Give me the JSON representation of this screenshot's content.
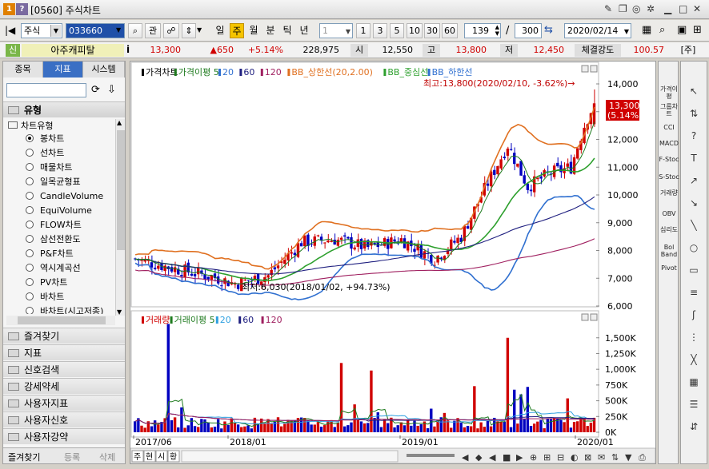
{
  "window": {
    "title": "[0560] 주식차트",
    "badge1": "1",
    "badge2": "?"
  },
  "toolbar": {
    "market": "주식",
    "code": "033660",
    "btn_gwan": "관",
    "period_labels": [
      "일",
      "주",
      "월",
      "분",
      "틱",
      "년"
    ],
    "selected_period": "주",
    "interval_value": "1",
    "interval_buttons": [
      "1",
      "3",
      "5",
      "10",
      "30",
      "60"
    ],
    "count_value": "139",
    "separator": "/",
    "total_value": "300",
    "date_value": "2020/02/14"
  },
  "quote": {
    "tag": "신",
    "name": "아주캐피탈",
    "info_icon": "i",
    "price": "13,300",
    "change": "▲650",
    "change_pct": "+5.14%",
    "volume": "228,975",
    "open_label": "시",
    "open": "12,550",
    "high_label": "고",
    "high": "13,800",
    "low_label": "저",
    "low": "12,450",
    "strength_label": "체결강도",
    "strength": "100.57",
    "unit": "[주]"
  },
  "left": {
    "tabs": [
      "종목",
      "지표",
      "시스템"
    ],
    "active_tab": "지표",
    "section_title": "유형",
    "tree_title": "차트유형",
    "chart_types": [
      "봉차트",
      "선차트",
      "매물차트",
      "일목균형표",
      "CandleVolume",
      "EquiVolume",
      "FLOW차트",
      "삼선전환도",
      "P&F차트",
      "역시계곡선",
      "PV차트",
      "바차트",
      "바차트(시고저종)"
    ],
    "selected_type": "봉차트",
    "folders": [
      "즐겨찾기",
      "지표",
      "신호검색",
      "강세약세",
      "사용자지표",
      "사용자신호",
      "사용자강약"
    ],
    "bottom_tabs": [
      "즐겨찾기",
      "등록",
      "삭제"
    ]
  },
  "chart": {
    "price_legend": [
      "가격차트",
      "가격이평 5",
      "20",
      "60",
      "120",
      "BB_상한선(20,2.00)",
      "BB_중심선",
      "BB_하한선"
    ],
    "volume_legend": [
      "거래량",
      "거래이평 5",
      "20",
      "60",
      "120"
    ],
    "max_annotation": "최고:13,800(2020/02/10, -3.62%)→",
    "min_annotation": "최저:6,030(2018/01/02, +94.73%)",
    "price_ticks": [
      "14,000",
      "13,000",
      "12,000",
      "11,000",
      "10,000",
      "9,000",
      "8,000",
      "7,000",
      "6,000"
    ],
    "volume_ticks": [
      "1,500K",
      "1,250K",
      "1,000K",
      "750K",
      "500K",
      "250K",
      "0K"
    ],
    "x_ticks": [
      "2017/06",
      "2018/01",
      "2019/01",
      "2020/01"
    ],
    "current_price_label": "13,300",
    "current_pct_label": "(5.14%)",
    "bottom_tabs": [
      "주",
      "현",
      "시",
      "황"
    ],
    "colors": {
      "up": "#d00000",
      "down": "#0000c0",
      "ma5": "#1f7b1f",
      "bb_upper": "#e07020",
      "bb_lower": "#3070d0",
      "ma20": "#2ea02e",
      "ma60": "#202080",
      "ma120": "#a02060"
    }
  },
  "rightbar": {
    "items": [
      "가격이평",
      "그룹차트",
      "CCI",
      "MACD",
      "F-Stoc",
      "S-Stoc",
      "거래량",
      "OBV",
      "심리도",
      "Bol Band",
      "Pivot"
    ]
  }
}
